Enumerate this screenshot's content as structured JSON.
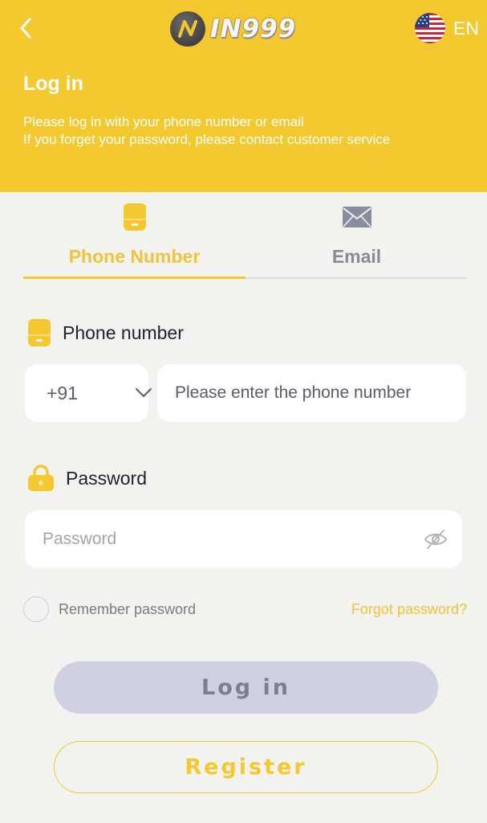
{
  "header": {
    "logo_text": "IN999",
    "language": "EN",
    "title": "Log in",
    "subtitle_lines": [
      "Please log in with your phone number or email",
      "If you forget your password, please contact customer service"
    ]
  },
  "tabs": [
    {
      "label": "Phone Number",
      "icon": "phone-icon",
      "active": true
    },
    {
      "label": "Email",
      "icon": "email-icon",
      "active": false
    }
  ],
  "phone_field": {
    "label": "Phone number",
    "country_code": "+91",
    "placeholder": "Please enter the phone number",
    "value": ""
  },
  "password_field": {
    "label": "Password",
    "placeholder": "Password",
    "value": ""
  },
  "remember": {
    "label": "Remember password",
    "checked": false
  },
  "forgot_label": "Forgot password?",
  "buttons": {
    "login": "Log in",
    "register": "Register"
  },
  "colors": {
    "accent": "#f3c92f",
    "background": "#f2f2ef",
    "login_button_bg": "#cfd0e0",
    "inactive_tab": "#8a8a97"
  }
}
